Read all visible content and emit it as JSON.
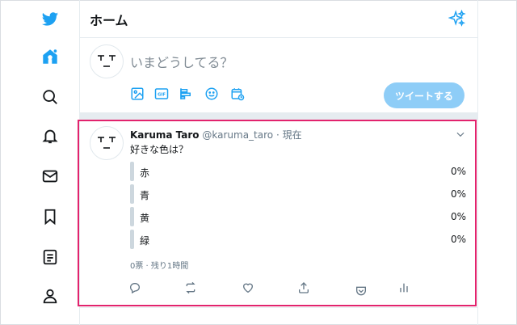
{
  "header": {
    "title": "ホーム"
  },
  "composer": {
    "prompt": "いまどうしてる？",
    "face": "━ ━\n ━",
    "tweet_button": "ツイートする"
  },
  "tweet": {
    "name": "Karuma Taro",
    "handle": "@karuma_taro",
    "time": "現在",
    "question": "好きな色は？",
    "options": [
      {
        "label": "赤",
        "percent": "0%"
      },
      {
        "label": "青",
        "percent": "0%"
      },
      {
        "label": "黄",
        "percent": "0%"
      },
      {
        "label": "緑",
        "percent": "0%"
      }
    ],
    "meta": "0票 · 残り1時間"
  },
  "colors": {
    "accent": "#1da1f2",
    "highlight": "#e2236d",
    "button": "#8ecdf7"
  },
  "icons": {
    "sidebar": [
      "twitter-logo-icon",
      "home-icon",
      "search-icon",
      "bell-icon",
      "mail-icon",
      "bookmark-icon",
      "list-icon",
      "profile-icon"
    ],
    "composer": [
      "image-icon",
      "gif-icon",
      "poll-icon",
      "emoji-icon",
      "schedule-icon"
    ],
    "actions": [
      "reply-icon",
      "retweet-icon",
      "like-icon",
      "share-icon",
      "pocket-icon",
      "analytics-icon"
    ]
  }
}
